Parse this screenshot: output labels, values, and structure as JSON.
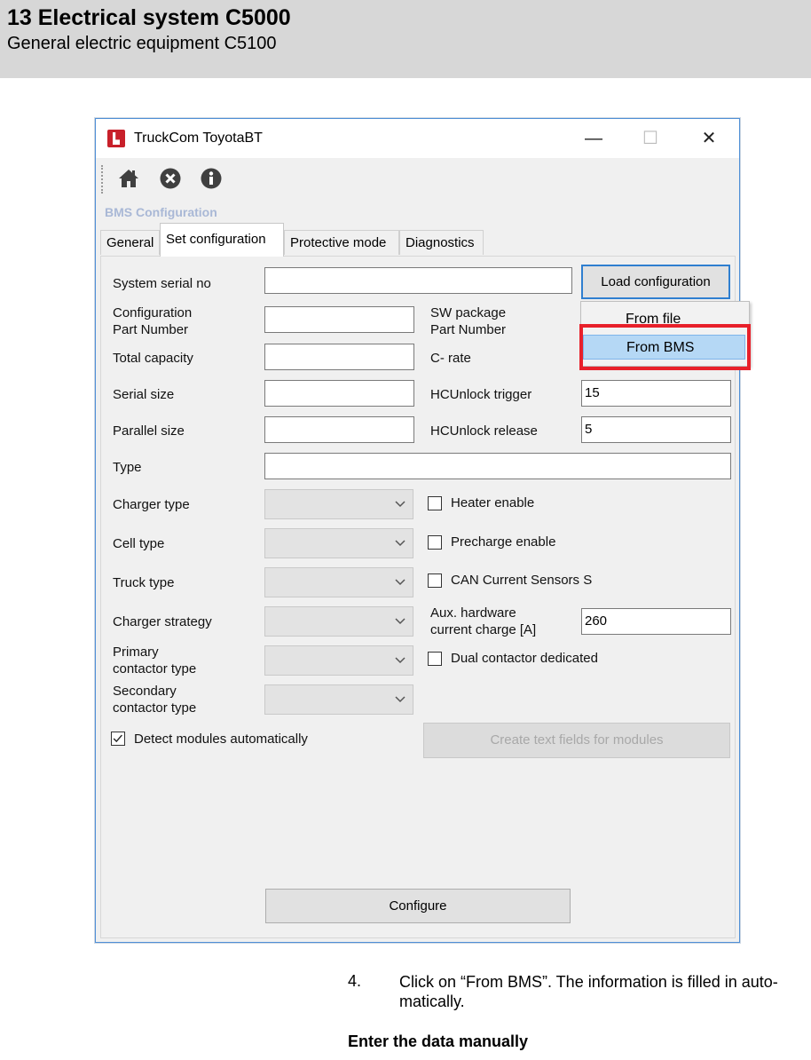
{
  "page_header": {
    "title": "13 Electrical system C5000",
    "subtitle": "General electric equipment C5100"
  },
  "window": {
    "title": "TruckCom ToyotaBT",
    "minimize": "—",
    "maximize": "☐",
    "close": "✕",
    "toolbar_icons": [
      "home-icon",
      "close-circle-icon",
      "info-icon"
    ],
    "section_label": "BMS Configuration",
    "tabs": [
      {
        "label": "General",
        "active": false
      },
      {
        "label": "Set configuration",
        "active": true
      },
      {
        "label": "Protective mode",
        "active": false
      },
      {
        "label": "Diagnostics",
        "active": false
      }
    ],
    "form": {
      "system_serial_no": {
        "label": "System serial no",
        "value": ""
      },
      "load_configuration": "Load configuration",
      "configuration_part_number": {
        "label": "Configuration\nPart Number",
        "value": ""
      },
      "sw_package_part_number": {
        "label": "SW package\nPart Number",
        "value": ""
      },
      "total_capacity": {
        "label": "Total capacity",
        "value": ""
      },
      "c_rate": {
        "label": "C- rate",
        "value": ""
      },
      "serial_size": {
        "label": "Serial size",
        "value": ""
      },
      "hcunlock_trigger": {
        "label": "HCUnlock trigger",
        "value": "15"
      },
      "parallel_size": {
        "label": "Parallel size",
        "value": ""
      },
      "hcunlock_release": {
        "label": "HCUnlock release",
        "value": "5"
      },
      "type": {
        "label": "Type",
        "value": ""
      },
      "charger_type": {
        "label": "Charger type",
        "value": ""
      },
      "cell_type": {
        "label": "Cell type",
        "value": ""
      },
      "truck_type": {
        "label": "Truck type",
        "value": ""
      },
      "charger_strategy": {
        "label": "Charger strategy",
        "value": ""
      },
      "primary_contactor_type": {
        "label": "Primary\ncontactor type",
        "value": ""
      },
      "secondary_contactor_type": {
        "label": "Secondary\ncontactor type",
        "value": ""
      },
      "heater_enable": {
        "label": "Heater enable",
        "checked": false
      },
      "precharge_enable": {
        "label": "Precharge enable",
        "checked": false
      },
      "can_current_sensors": {
        "label": "CAN Current Sensors S",
        "checked": false
      },
      "aux_hardware_current_charge": {
        "label": "Aux. hardware\ncurrent charge [A]",
        "value": "260"
      },
      "dual_contactor_dedicated": {
        "label": "Dual contactor dedicated",
        "checked": false
      },
      "detect_modules_automatically": {
        "label": "Detect modules automatically",
        "checked": true
      },
      "create_text_fields": "Create text fields for modules",
      "configure": "Configure"
    },
    "dropdown_menu": {
      "items": [
        "From file",
        "From BMS"
      ],
      "highlighted": "From BMS",
      "highlight_color": "#e8202a"
    }
  },
  "instructions": {
    "step_number": "4.",
    "step_text": "Click on “From BMS”. The information is filled in auto-matically.",
    "subheading": "Enter the data manually"
  }
}
